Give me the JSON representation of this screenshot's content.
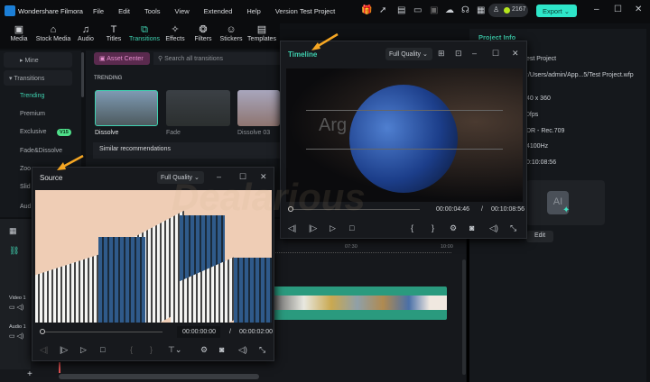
{
  "app": {
    "name": "Wondershare Filmora",
    "project_title": "Test Project",
    "credits": "2167",
    "export_label": "Export",
    "watermark": "Dealarious"
  },
  "menu": [
    "File",
    "Edit",
    "Tools",
    "View",
    "Extended",
    "Help",
    "Version"
  ],
  "toolbar": [
    {
      "label": "Media",
      "icon": "media-icon"
    },
    {
      "label": "Stock Media",
      "icon": "stock-media-icon"
    },
    {
      "label": "Audio",
      "icon": "music-note-icon"
    },
    {
      "label": "Titles",
      "icon": "text-t-icon"
    },
    {
      "label": "Transitions",
      "icon": "transitions-icon"
    },
    {
      "label": "Effects",
      "icon": "effects-icon"
    },
    {
      "label": "Filters",
      "icon": "filters-icon"
    },
    {
      "label": "Stickers",
      "icon": "stickers-icon"
    },
    {
      "label": "Templates",
      "icon": "templates-icon"
    }
  ],
  "sidebar": {
    "items": [
      "Mine",
      "Transitions",
      "Trending",
      "Premium",
      "Exclusive",
      "Fade&Dissolve",
      "Zoo",
      "Slid",
      "Aud"
    ],
    "exclusive_badge": "V15"
  },
  "content": {
    "asset_center": "Asset Center",
    "search_placeholder": "Search all transitions",
    "section": "TRENDING",
    "thumbs": [
      "Dissolve",
      "Fade",
      "Dissolve 03"
    ],
    "similar": "Similar recommendations"
  },
  "project_info": {
    "title": "Project Info",
    "values": [
      "est Project",
      ":/Users/admin/App...5/Test Project.wfp",
      "40 x 360",
      "0fps",
      "DR - Rec.709",
      "4100Hz",
      "0:10:08:56"
    ],
    "edit_label": "Edit"
  },
  "timeline_window": {
    "title": "Timeline",
    "quality": "Full Quality",
    "current": "00:00:04:46",
    "sep": "/",
    "total": "00:10:08:56",
    "video_text": "Arg",
    "progress": 0.01
  },
  "source_window": {
    "title": "Source",
    "quality": "Full Quality",
    "current": "00:00:00:00",
    "sep": "/",
    "total": "00:00:02:00",
    "progress": 0
  },
  "timeline": {
    "ruler": [
      "07:30",
      "10:00"
    ],
    "tracks": [
      "Video 1",
      "Audio 1"
    ]
  },
  "colors": {
    "accent": "#3fd1b0",
    "export": "#2ee6c9",
    "clip": "#2a9a7e",
    "arrow": "#f5a623"
  }
}
